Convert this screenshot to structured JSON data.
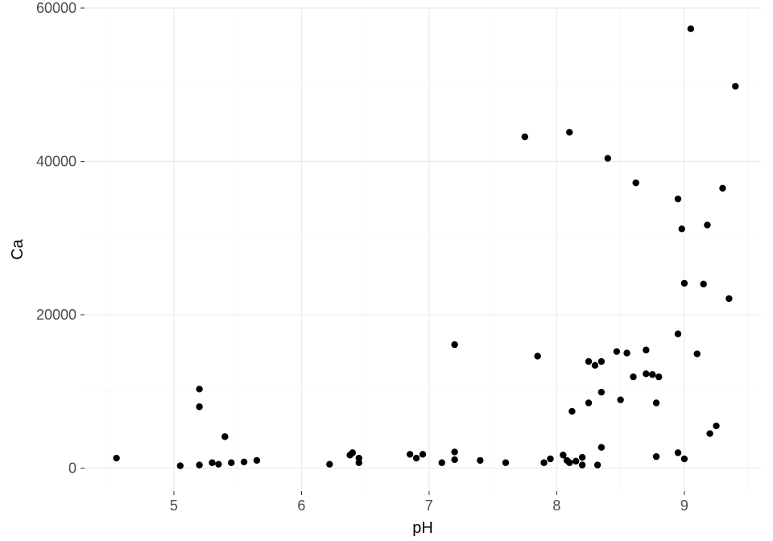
{
  "chart_data": {
    "type": "scatter",
    "xlabel": "pH",
    "ylabel": "Ca",
    "xlim": [
      4.3,
      9.6
    ],
    "ylim": [
      -3000,
      60000
    ],
    "x_ticks": [
      5,
      6,
      7,
      8,
      9
    ],
    "y_ticks": [
      0,
      20000,
      40000,
      60000
    ],
    "x_minor": [
      4.5,
      5.5,
      6.5,
      7.5,
      8.5,
      9.5
    ],
    "y_minor": [
      10000,
      30000,
      50000
    ],
    "point_color": "#000000",
    "point_radius": 4.2,
    "points": [
      {
        "x": 4.55,
        "y": 1300
      },
      {
        "x": 5.05,
        "y": 300
      },
      {
        "x": 5.2,
        "y": 10300
      },
      {
        "x": 5.2,
        "y": 8000
      },
      {
        "x": 5.2,
        "y": 400
      },
      {
        "x": 5.3,
        "y": 700
      },
      {
        "x": 5.35,
        "y": 500
      },
      {
        "x": 5.4,
        "y": 4100
      },
      {
        "x": 5.45,
        "y": 700
      },
      {
        "x": 5.55,
        "y": 800
      },
      {
        "x": 5.65,
        "y": 1000
      },
      {
        "x": 6.22,
        "y": 500
      },
      {
        "x": 6.38,
        "y": 1700
      },
      {
        "x": 6.4,
        "y": 2000
      },
      {
        "x": 6.45,
        "y": 1300
      },
      {
        "x": 6.45,
        "y": 700
      },
      {
        "x": 6.85,
        "y": 1800
      },
      {
        "x": 6.9,
        "y": 1300
      },
      {
        "x": 6.95,
        "y": 1800
      },
      {
        "x": 7.1,
        "y": 700
      },
      {
        "x": 7.2,
        "y": 16100
      },
      {
        "x": 7.2,
        "y": 2100
      },
      {
        "x": 7.2,
        "y": 1100
      },
      {
        "x": 7.4,
        "y": 1000
      },
      {
        "x": 7.6,
        "y": 700
      },
      {
        "x": 7.75,
        "y": 43200
      },
      {
        "x": 7.85,
        "y": 14600
      },
      {
        "x": 7.9,
        "y": 700
      },
      {
        "x": 7.95,
        "y": 1200
      },
      {
        "x": 8.05,
        "y": 1700
      },
      {
        "x": 8.08,
        "y": 1000
      },
      {
        "x": 8.1,
        "y": 43800
      },
      {
        "x": 8.1,
        "y": 700
      },
      {
        "x": 8.12,
        "y": 7400
      },
      {
        "x": 8.15,
        "y": 900
      },
      {
        "x": 8.2,
        "y": 400
      },
      {
        "x": 8.2,
        "y": 1400
      },
      {
        "x": 8.25,
        "y": 8500
      },
      {
        "x": 8.25,
        "y": 13900
      },
      {
        "x": 8.3,
        "y": 13400
      },
      {
        "x": 8.32,
        "y": 400
      },
      {
        "x": 8.35,
        "y": 13900
      },
      {
        "x": 8.35,
        "y": 9900
      },
      {
        "x": 8.35,
        "y": 2700
      },
      {
        "x": 8.4,
        "y": 40400
      },
      {
        "x": 8.47,
        "y": 15200
      },
      {
        "x": 8.5,
        "y": 8900
      },
      {
        "x": 8.55,
        "y": 15000
      },
      {
        "x": 8.6,
        "y": 11900
      },
      {
        "x": 8.62,
        "y": 37200
      },
      {
        "x": 8.7,
        "y": 15400
      },
      {
        "x": 8.7,
        "y": 12300
      },
      {
        "x": 8.75,
        "y": 12200
      },
      {
        "x": 8.78,
        "y": 1500
      },
      {
        "x": 8.78,
        "y": 8500
      },
      {
        "x": 8.8,
        "y": 11900
      },
      {
        "x": 8.95,
        "y": 35100
      },
      {
        "x": 8.95,
        "y": 17500
      },
      {
        "x": 8.95,
        "y": 2000
      },
      {
        "x": 8.98,
        "y": 31200
      },
      {
        "x": 9.0,
        "y": 24100
      },
      {
        "x": 9.0,
        "y": 1200
      },
      {
        "x": 9.05,
        "y": 57300
      },
      {
        "x": 9.1,
        "y": 14900
      },
      {
        "x": 9.15,
        "y": 24000
      },
      {
        "x": 9.18,
        "y": 31700
      },
      {
        "x": 9.2,
        "y": 4500
      },
      {
        "x": 9.25,
        "y": 5500
      },
      {
        "x": 9.3,
        "y": 36500
      },
      {
        "x": 9.35,
        "y": 22100
      },
      {
        "x": 9.4,
        "y": 49800
      }
    ]
  }
}
